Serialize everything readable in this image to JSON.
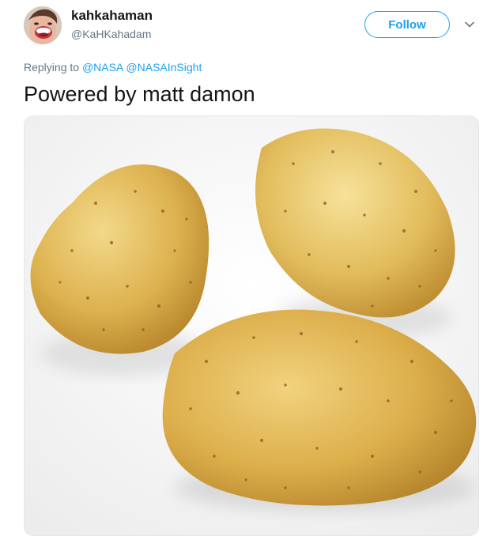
{
  "author": {
    "display_name": "kahkahaman",
    "handle": "@KaHKahadam"
  },
  "actions": {
    "follow_label": "Follow"
  },
  "reply": {
    "prefix": "Replying to ",
    "mentions": [
      "@NASA",
      "@NASAInSight"
    ]
  },
  "tweet": {
    "text": "Powered by matt damon"
  },
  "media": {
    "subject": "three potatoes"
  },
  "colors": {
    "accent": "#1da1f2",
    "text_primary": "#14171a",
    "text_secondary": "#657786",
    "border": "#e1e8ed"
  },
  "icons": {
    "caret": "chevron-down-icon"
  }
}
